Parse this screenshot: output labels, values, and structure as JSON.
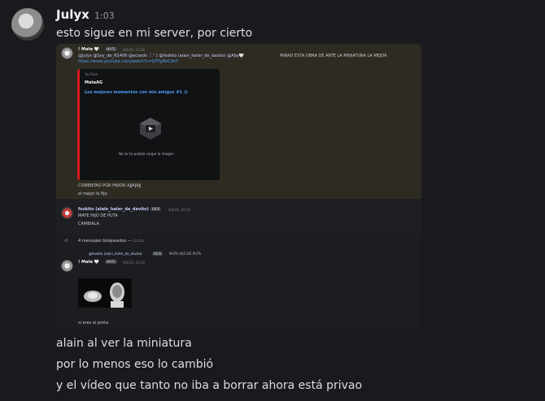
{
  "message": {
    "author": "Julyx",
    "time": "1:03",
    "text_before": "esto sigue en mi server, por cierto",
    "text_after": [
      "alain al ver la miniatura",
      "por lo menos eso lo cambió",
      "y el vídeo que tanto no iba a borrar ahora está privao"
    ]
  },
  "screenshot": {
    "msg1": {
      "author": "! Mate 🤍",
      "badge": "MATE",
      "time": "4/6/26, 21:28",
      "mentions": "@Julyx @Soy_de_N1406 @ecoxdv .ᐟ.ᐟ ◊ @foskito (alain_hater_de_davito) @Aby🤍",
      "text": "MIRAD ESTA OBRA DE ARTE LA MINIATURA LA MEJOR",
      "url": "https://www.youtube.com/watch?v=GFFgMzC9hY"
    },
    "embed": {
      "provider": "YouTube",
      "channel": "MateAG",
      "title": "Los mejores momentos con mis amigos #1 😋",
      "error": "No se ha podido cargar la imagen."
    },
    "msg1_extra": [
      "COMENTAD POR FAVOR AJJAJAJJ",
      "el mejor lo fijo"
    ],
    "msg2": {
      "author": "foskito (alain_hater_de_davito)",
      "badge": "RICK",
      "time": "4/6/26, 22:34",
      "lines": [
        "MATE HIJO DE PUTA",
        "CAMBIALA"
      ]
    },
    "blocked": {
      "text": "4 mensajes bloqueados",
      "action": "Ocultar"
    },
    "reply": {
      "author": "@foskito (alain_hater_de_davito)",
      "badge": "RICK",
      "text": "MATE HIJO DE PUTA"
    },
    "msg3": {
      "author": "! Mate 🤍",
      "badge": "MATE",
      "time": "4/6/26, 22:34",
      "caption": "si eres el prota"
    }
  },
  "colors": {
    "background": "#1a1a1e",
    "link": "#4e9cf5",
    "embed_accent": "#d21b1b"
  }
}
